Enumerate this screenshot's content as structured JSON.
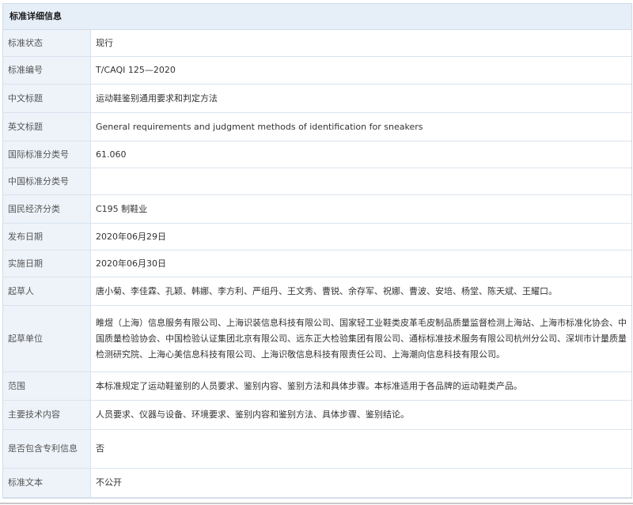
{
  "panel": {
    "title": "标准详细信息"
  },
  "rows": [
    {
      "label": "标准状态",
      "value": "现行"
    },
    {
      "label": "标准编号",
      "value": "T/CAQI 125—2020"
    },
    {
      "label": "中文标题",
      "value": "运动鞋鉴别通用要求和判定方法"
    },
    {
      "label": "英文标题",
      "value": "General requirements and judgment methods of identification for sneakers"
    },
    {
      "label": "国际标准分类号",
      "value": "61.060"
    },
    {
      "label": "中国标准分类号",
      "value": ""
    },
    {
      "label": "国民经济分类",
      "value": "C195 制鞋业"
    },
    {
      "label": "发布日期",
      "value": "2020年06月29日"
    },
    {
      "label": "实施日期",
      "value": "2020年06月30日"
    },
    {
      "label": "起草人",
      "value": "唐小菊、李佳霖、孔颖、韩娜、李方利、严组丹、王文秀、曹锐、余存军、祝娜、曹波、安培、杨堂、陈天斌、王耀口。"
    },
    {
      "label": "起草单位",
      "value": "睢煜（上海）信息服务有限公司、上海识装信息科技有限公司、国家轻工业鞋类皮革毛皮制品质量监督检测上海站、上海市标准化协会、中国质量检验协会、中国检验认证集团北京有限公司、远东正大检验集团有限公司、通标标准技术服务有限公司杭州分公司、深圳市计量质量检测研究院、上海心美信息科技有限公司、上海识敬信息科技有限责任公司、上海潮向信息科技有限公司。"
    },
    {
      "label": "范围",
      "value": "本标准规定了运动鞋鉴别的人员要求、鉴别内容、鉴别方法和具体步骤。本标准适用于各品牌的运动鞋类产品。"
    },
    {
      "label": "主要技术内容",
      "value": "人员要求、仪器与设备、环境要求、鉴别内容和鉴别方法、具体步骤、鉴别结论。"
    },
    {
      "label": "是否包含专利信息",
      "value": "否"
    },
    {
      "label": "标准文本",
      "value": "不公开"
    }
  ]
}
